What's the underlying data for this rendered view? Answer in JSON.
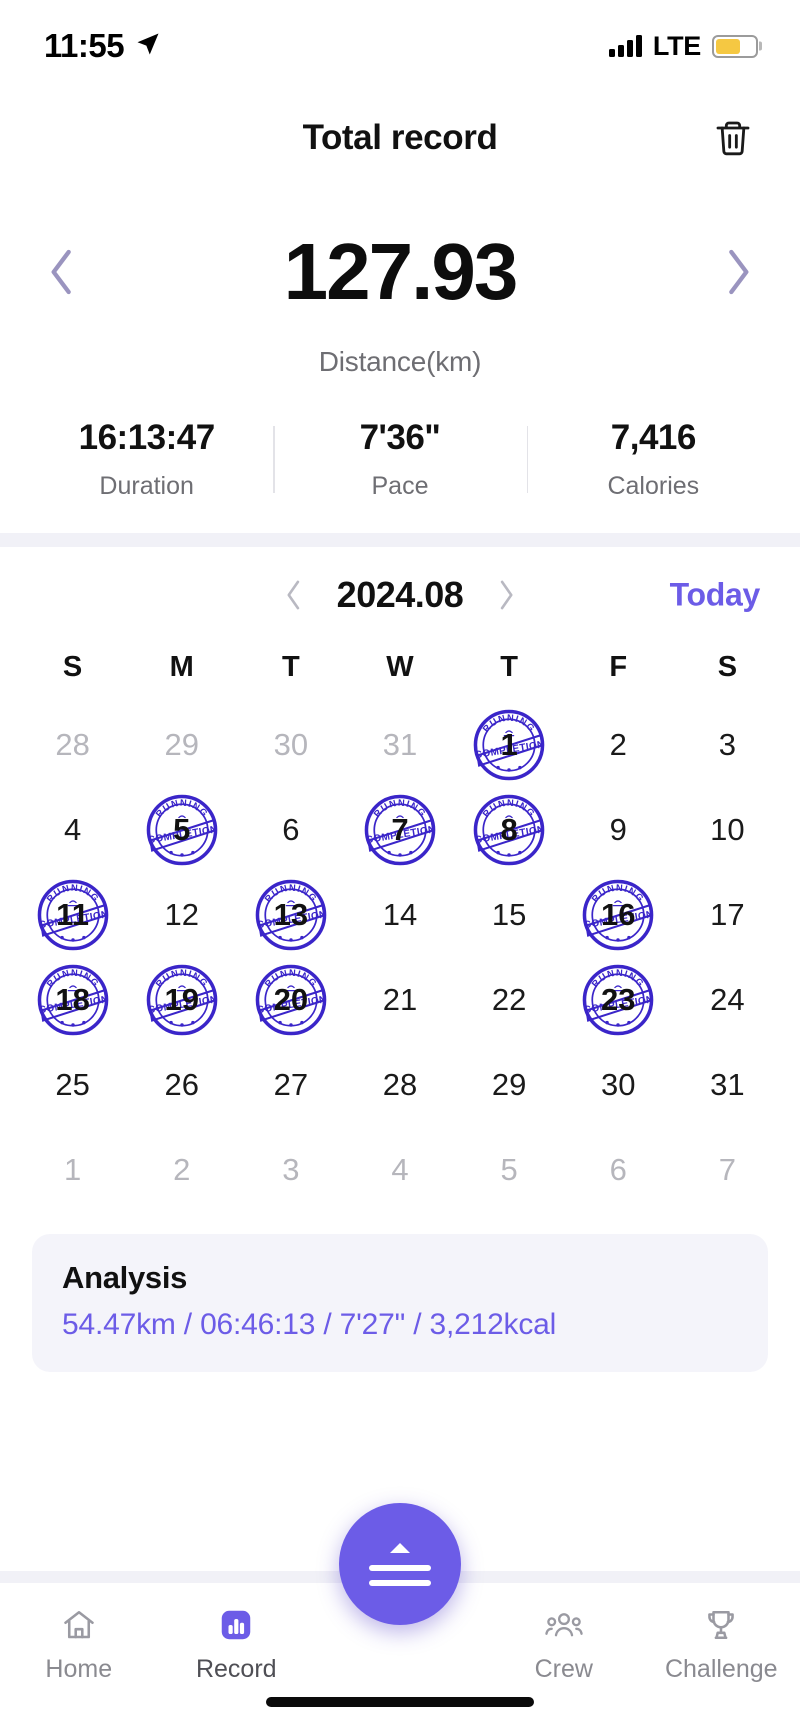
{
  "status_bar": {
    "time": "11:55",
    "location_icon": "location-arrow-icon",
    "signal_icon": "cellular-signal-icon",
    "network": "LTE",
    "battery_icon": "battery-icon",
    "battery_color": "#f5c842"
  },
  "header": {
    "title": "Total record",
    "delete_icon": "trash-icon"
  },
  "summary": {
    "prev_icon": "chevron-left-icon",
    "next_icon": "chevron-right-icon",
    "distance_value": "127.93",
    "distance_label": "Distance(km)",
    "stats": [
      {
        "value": "16:13:47",
        "label": "Duration"
      },
      {
        "value": "7'36\"",
        "label": "Pace"
      },
      {
        "value": "7,416",
        "label": "Calories"
      }
    ]
  },
  "calendar": {
    "prev_icon": "chevron-left-icon",
    "month": "2024.08",
    "next_icon": "chevron-right-icon",
    "today_label": "Today",
    "weekdays": [
      "S",
      "M",
      "T",
      "W",
      "T",
      "F",
      "S"
    ],
    "stamp": {
      "top_text": "RUNNING",
      "banner_text": "COMPLETION",
      "color": "#3a25c9"
    },
    "days": [
      {
        "n": "28",
        "muted": true,
        "stamped": false
      },
      {
        "n": "29",
        "muted": true,
        "stamped": false
      },
      {
        "n": "30",
        "muted": true,
        "stamped": false
      },
      {
        "n": "31",
        "muted": true,
        "stamped": false
      },
      {
        "n": "1",
        "muted": false,
        "stamped": true
      },
      {
        "n": "2",
        "muted": false,
        "stamped": false
      },
      {
        "n": "3",
        "muted": false,
        "stamped": false
      },
      {
        "n": "4",
        "muted": false,
        "stamped": false
      },
      {
        "n": "5",
        "muted": false,
        "stamped": true
      },
      {
        "n": "6",
        "muted": false,
        "stamped": false
      },
      {
        "n": "7",
        "muted": false,
        "stamped": true
      },
      {
        "n": "8",
        "muted": false,
        "stamped": true
      },
      {
        "n": "9",
        "muted": false,
        "stamped": false
      },
      {
        "n": "10",
        "muted": false,
        "stamped": false
      },
      {
        "n": "11",
        "muted": false,
        "stamped": true
      },
      {
        "n": "12",
        "muted": false,
        "stamped": false
      },
      {
        "n": "13",
        "muted": false,
        "stamped": true
      },
      {
        "n": "14",
        "muted": false,
        "stamped": false
      },
      {
        "n": "15",
        "muted": false,
        "stamped": false
      },
      {
        "n": "16",
        "muted": false,
        "stamped": true
      },
      {
        "n": "17",
        "muted": false,
        "stamped": false
      },
      {
        "n": "18",
        "muted": false,
        "stamped": true
      },
      {
        "n": "19",
        "muted": false,
        "stamped": true
      },
      {
        "n": "20",
        "muted": false,
        "stamped": true
      },
      {
        "n": "21",
        "muted": false,
        "stamped": false
      },
      {
        "n": "22",
        "muted": false,
        "stamped": false
      },
      {
        "n": "23",
        "muted": false,
        "stamped": true
      },
      {
        "n": "24",
        "muted": false,
        "stamped": false
      },
      {
        "n": "25",
        "muted": false,
        "stamped": false
      },
      {
        "n": "26",
        "muted": false,
        "stamped": false
      },
      {
        "n": "27",
        "muted": false,
        "stamped": false
      },
      {
        "n": "28",
        "muted": false,
        "stamped": false
      },
      {
        "n": "29",
        "muted": false,
        "stamped": false
      },
      {
        "n": "30",
        "muted": false,
        "stamped": false
      },
      {
        "n": "31",
        "muted": false,
        "stamped": false
      },
      {
        "n": "1",
        "muted": true,
        "stamped": false
      },
      {
        "n": "2",
        "muted": true,
        "stamped": false
      },
      {
        "n": "3",
        "muted": true,
        "stamped": false
      },
      {
        "n": "4",
        "muted": true,
        "stamped": false
      },
      {
        "n": "5",
        "muted": true,
        "stamped": false
      },
      {
        "n": "6",
        "muted": true,
        "stamped": false
      },
      {
        "n": "7",
        "muted": true,
        "stamped": false
      }
    ]
  },
  "analysis": {
    "title": "Analysis",
    "summary": "54.47km / 06:46:13 / 7'27\" / 3,212kcal"
  },
  "fab": {
    "chevron_icon": "chevron-up-icon",
    "menu_icon": "hamburger-menu-icon"
  },
  "bottom_nav": {
    "items": [
      {
        "label": "Home",
        "icon": "home-icon",
        "active": false
      },
      {
        "label": "Record",
        "icon": "bar-chart-icon",
        "active": true
      },
      {
        "label": "Crew",
        "icon": "people-icon",
        "active": false
      },
      {
        "label": "Challenge",
        "icon": "trophy-icon",
        "active": false
      }
    ],
    "active_color": "#6c5ce7"
  }
}
